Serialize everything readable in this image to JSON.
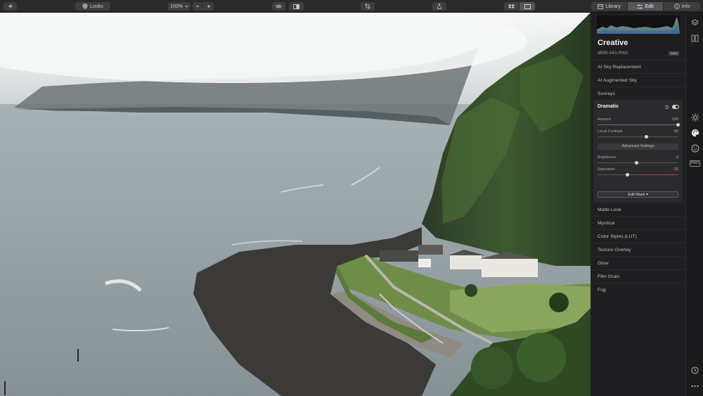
{
  "toolbar": {
    "looks_label": "Looks",
    "zoom_value": "100%",
    "tabs": [
      {
        "label": "Library"
      },
      {
        "label": "Edit"
      },
      {
        "label": "Info"
      }
    ]
  },
  "panel": {
    "section_title": "Creative",
    "file_name": "d898-543.RW2",
    "file_badge": "RAW",
    "tools_above": [
      {
        "label": "AI Sky Replacement"
      },
      {
        "label": "AI Augmented Sky"
      },
      {
        "label": "Sunrays"
      }
    ],
    "dramatic": {
      "title": "Dramatic",
      "amount": {
        "label": "Amount",
        "value": "100",
        "level": 1.0
      },
      "local_contrast": {
        "label": "Local Contrast",
        "value": "60",
        "level": 0.6
      },
      "advanced_label": "Advanced Settings",
      "brightness": {
        "label": "Brightness",
        "value": "-3",
        "level": 0.485
      },
      "saturation": {
        "label": "Saturation",
        "value": "-25",
        "level": 0.375
      },
      "edit_mask_label": "Edit Mask"
    },
    "tools_below": [
      {
        "label": "Matte Look"
      },
      {
        "label": "Mystical"
      },
      {
        "label": "Color Styles (LUT)"
      },
      {
        "label": "Texture Overlay"
      },
      {
        "label": "Glow"
      },
      {
        "label": "Film Grain"
      },
      {
        "label": "Fog"
      }
    ]
  },
  "iconbar": {
    "pro_label": "PRO"
  },
  "colors": {
    "accent": "#3b82c4",
    "panel_bg": "#1f1f21",
    "toolbar_bg": "#2a2a2c"
  }
}
